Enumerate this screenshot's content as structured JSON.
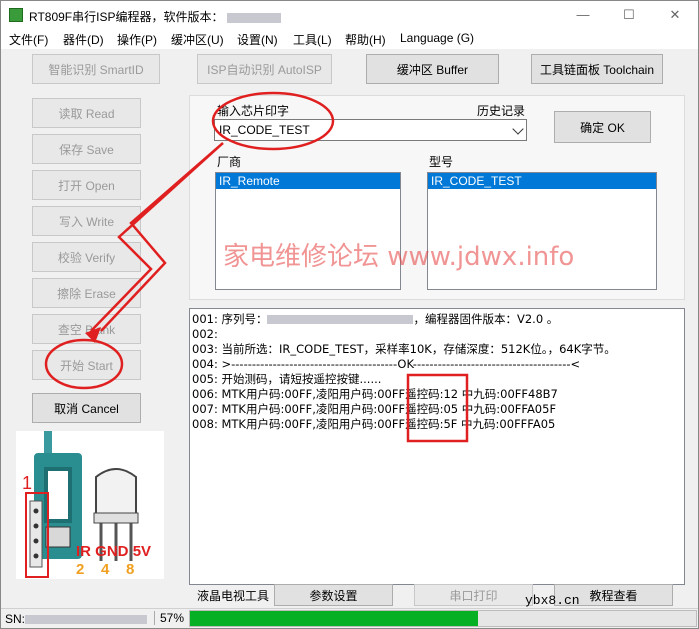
{
  "window": {
    "title": "RT809F串行ISP编程器，软件版本：",
    "min_icon": "minimize-icon",
    "max_icon": "maximize-icon",
    "close_icon": "close-icon"
  },
  "menu": [
    "文件(F)",
    "器件(D)",
    "操作(P)",
    "缓冲区(U)",
    "设置(N)",
    "工具(L)",
    "帮助(H)",
    "Language (G)"
  ],
  "toolbar": {
    "smart_id": "智能识别 SmartID",
    "isp_auto": "ISP自动识别 AutoISP",
    "buffer": "缓冲区 Buffer",
    "toolchain": "工具链面板 Toolchain"
  },
  "side_buttons": {
    "read": "读取 Read",
    "save": "保存 Save",
    "open": "打开 Open",
    "write": "写入 Write",
    "verify": "校验 Verify",
    "erase": "擦除 Erase",
    "blank": "查空 Blank",
    "start": "开始 Start",
    "cancel": "取消 Cancel"
  },
  "chip_panel": {
    "input_label": "输入芯片印字",
    "history_label": "历史记录",
    "input_value": "IR_CODE_TEST",
    "ok_button": "确定 OK",
    "vendor_label": "厂商",
    "model_label": "型号",
    "vendor_selected": "IR_Remote",
    "model_selected": "IR_CODE_TEST"
  },
  "watermark": "家电维修论坛 www.jdwx.info",
  "log": [
    {
      "prefix": "001: 序列号：",
      "suffix": "，编程器固件版本：V2.0 。"
    },
    {
      "text": "002:"
    },
    {
      "text": "003: 当前所选：IR_CODE_TEST，采样率10K，存储深度：512K位。，64K字节。"
    },
    {
      "text": "004: >----------------------------------------OK--------------------------------------<"
    },
    {
      "text": "005: 开始测码，请短按遥控按键......"
    },
    {
      "text": "006: MTK用户码:00FF,凌阳用户码:00FF遥控码:12 中九码:00FF48B7"
    },
    {
      "text": "007: MTK用户码:00FF,凌阳用户码:00FF遥控码:05 中九码:00FFA05F"
    },
    {
      "text": "008: MTK用户码:00FF,凌阳用户码:00FF遥控码:5F 中九码:00FFFA05"
    }
  ],
  "device_image": {
    "pin_number": "1",
    "pin_labels": [
      "IR",
      "GND",
      "5V"
    ],
    "pin_numbers": [
      "2",
      "4",
      "8"
    ]
  },
  "bottom_bar": {
    "lcd_tool": "液晶电视工具",
    "params": "参数设置",
    "serial_print": "串口打印",
    "tutorial": "教程查看"
  },
  "status": {
    "sn_label": "SN:",
    "percent": "57%",
    "progress": 0.57,
    "site_mark": "ybx8.cn"
  },
  "colors": {
    "progress_green": "#06b025",
    "annotation_red": "#e02020",
    "selection_blue": "#0078d7"
  }
}
